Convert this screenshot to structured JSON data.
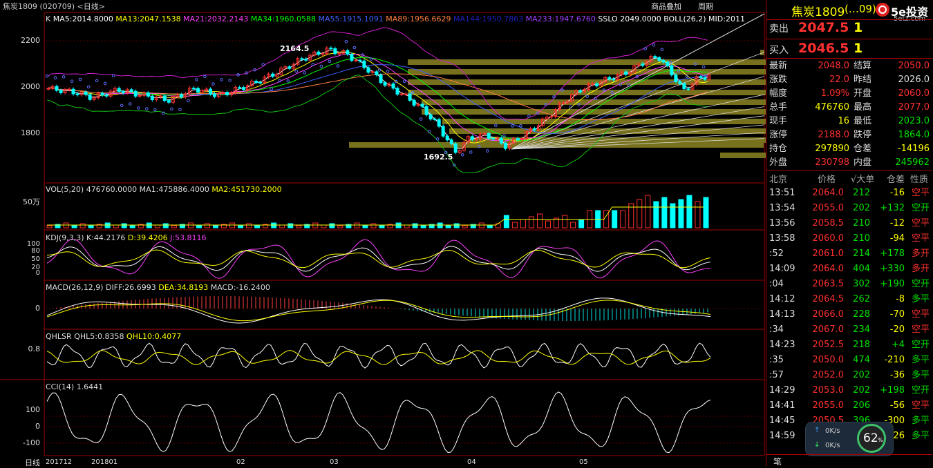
{
  "header": {
    "title": "焦炭1809 (020709) <日线>",
    "overlay_btn": "商品叠加",
    "period_btn": "周期",
    "period_tag": "日线"
  },
  "main_panel": {
    "label_k": "K",
    "ma": [
      {
        "text": "MA5:2014.8000",
        "color": "#ffffff"
      },
      {
        "text": "MA13:2047.1538",
        "color": "#ffff00"
      },
      {
        "text": "MA21:2032.2143",
        "color": "#ff40ff"
      },
      {
        "text": "MA34:1960.0588",
        "color": "#00ff00"
      },
      {
        "text": "MA55:1915.1091",
        "color": "#4060ff"
      },
      {
        "text": "MA89:1956.6629",
        "color": "#ff8040"
      },
      {
        "text": "MA144:1950.7863",
        "color": "#2020c0"
      },
      {
        "text": "MA233:1947.6760",
        "color": "#a040ff"
      },
      {
        "text": "SSLO 2049.0000",
        "color": "#ffffff"
      },
      {
        "text": "BOLL(26,2) MID:2011",
        "color": "#ffffff"
      }
    ],
    "y_ticks": [
      "2200",
      "2000",
      "1800"
    ],
    "high_label": "2164.5",
    "low_label": "1692.5"
  },
  "vol_panel": {
    "label": "VOL(5,20) 476760.0000",
    "ma1": "MA1:475886.4000",
    "ma2": "MA2:451730.2000",
    "y_tick": "50万"
  },
  "kdj_panel": {
    "label": "KDJ(9,3,3)",
    "k": "K:44.2176",
    "d": "D:39.4206",
    "j": "J:53.8116",
    "y_ticks": [
      "100",
      "80",
      "50",
      "20",
      "0"
    ]
  },
  "macd_panel": {
    "label": "MACD(26,12,9)",
    "diff": "DIFF:26.6993",
    "dea": "DEA:34.8193",
    "macd": "MACD:-16.2400",
    "y_tick": "0"
  },
  "qhlsr_panel": {
    "label": "QHLSR",
    "qhl5": "QHL5:0.8358",
    "qhl10": "QHL10:0.4077",
    "y_tick": "0.8"
  },
  "cci_panel": {
    "label": "CCI(14)",
    "value": "1.6441",
    "y_ticks": [
      "100",
      "0",
      "-100"
    ]
  },
  "x_axis": [
    "201712",
    "201801",
    "02",
    "03",
    "04",
    "05"
  ],
  "right": {
    "name": "焦炭1809",
    "name_suffix": "(…09)",
    "brand": "5e投资",
    "brand_url": "5etz.com",
    "ask_label": "卖出",
    "ask_price": "2047.5",
    "ask_vol": "1",
    "bid_label": "买入",
    "bid_price": "2046.5",
    "bid_vol": "1",
    "stats": [
      {
        "l1": "最新",
        "v1": "2048.0",
        "c1": "red",
        "l2": "结算",
        "v2": "2050.0",
        "c2": "red"
      },
      {
        "l1": "涨跌",
        "v1": "22.0",
        "c1": "red",
        "l2": "昨结",
        "v2": "2026.0",
        "c2": "white"
      },
      {
        "l1": "幅度",
        "v1": "1.09%",
        "c1": "red",
        "l2": "开盘",
        "v2": "2060.0",
        "c2": "red"
      },
      {
        "l1": "总手",
        "v1": "476760",
        "c1": "yellow",
        "l2": "最高",
        "v2": "2077.0",
        "c2": "red"
      },
      {
        "l1": "现手",
        "v1": "16",
        "c1": "yellow",
        "l2": "最低",
        "v2": "2023.0",
        "c2": "green"
      },
      {
        "l1": "涨停",
        "v1": "2188.0",
        "c1": "red",
        "l2": "跌停",
        "v2": "1864.0",
        "c2": "green"
      },
      {
        "l1": "持仓",
        "v1": "297890",
        "c1": "yellow",
        "l2": "仓差",
        "v2": "-14196",
        "c2": "yellow"
      },
      {
        "l1": "外盘",
        "v1": "230798",
        "c1": "red",
        "l2": "内盘",
        "v2": "245962",
        "c2": "green"
      }
    ],
    "tick_headers": [
      "北京",
      "价格",
      "√大单",
      "仓差",
      "性质"
    ],
    "ticks": [
      {
        "t": "13:51",
        "p": "2064.0",
        "v": "212",
        "d": "-16",
        "n": "空平",
        "nc": "red"
      },
      {
        "t": "13:54",
        "p": "2055.0",
        "v": "202",
        "d": "+132",
        "n": "空开",
        "nc": "green"
      },
      {
        "t": "13:56",
        "p": "2058.5",
        "v": "210",
        "d": "-12",
        "n": "空平",
        "nc": "red"
      },
      {
        "t": "13:58",
        "p": "2060.0",
        "v": "210",
        "d": "-94",
        "n": "空平",
        "nc": "red"
      },
      {
        "t": ":52",
        "p": "2061.0",
        "v": "214",
        "d": "+178",
        "n": "多开",
        "nc": "red"
      },
      {
        "t": "14:09",
        "p": "2064.0",
        "v": "404",
        "d": "+330",
        "n": "多开",
        "nc": "red"
      },
      {
        "t": ":04",
        "p": "2063.5",
        "v": "302",
        "d": "+190",
        "n": "空开",
        "nc": "green"
      },
      {
        "t": "14:12",
        "p": "2064.5",
        "v": "262",
        "d": "-8",
        "n": "多平",
        "nc": "green"
      },
      {
        "t": "14:13",
        "p": "2066.0",
        "v": "228",
        "d": "-70",
        "n": "空平",
        "nc": "red"
      },
      {
        "t": ":34",
        "p": "2067.0",
        "v": "234",
        "d": "-20",
        "n": "空平",
        "nc": "red"
      },
      {
        "t": "14:23",
        "p": "2052.5",
        "v": "218",
        "d": "+4",
        "n": "空开",
        "nc": "green"
      },
      {
        "t": ":35",
        "p": "2050.0",
        "v": "474",
        "d": "-210",
        "n": "多平",
        "nc": "green"
      },
      {
        "t": ":57",
        "p": "2052.0",
        "v": "202",
        "d": "-36",
        "n": "多平",
        "nc": "green"
      },
      {
        "t": "14:29",
        "p": "2053.0",
        "v": "202",
        "d": "+198",
        "n": "空开",
        "nc": "green"
      },
      {
        "t": "14:41",
        "p": "2055.0",
        "v": "206",
        "d": "-56",
        "n": "空平",
        "nc": "red"
      },
      {
        "t": "14:45",
        "p": "2050.5",
        "v": "396",
        "d": "-300",
        "n": "多平",
        "nc": "green"
      },
      {
        "t": "14:59",
        "p": "2053.0",
        "v": "",
        "d": "-26",
        "n": "多平",
        "nc": "green"
      }
    ],
    "net_up": "0K/s",
    "net_down": "0K/s",
    "net_pct": "62",
    "bottom_tab": "笔"
  }
}
